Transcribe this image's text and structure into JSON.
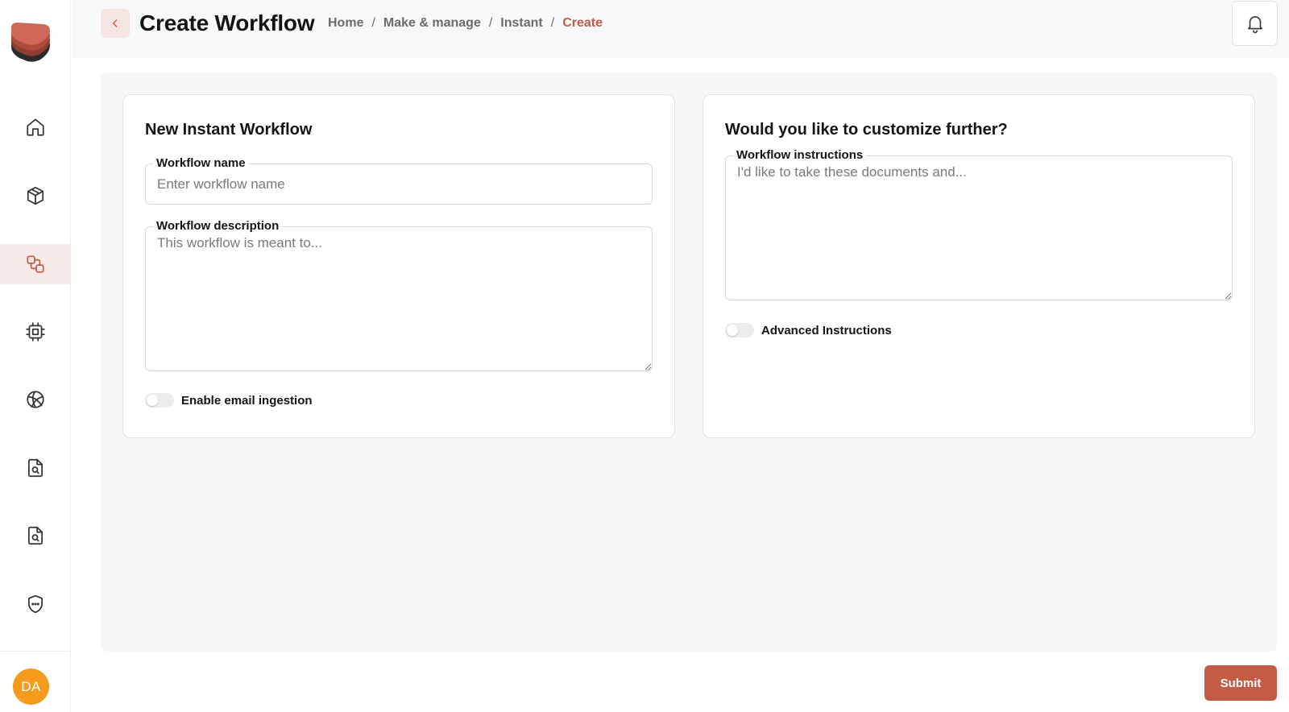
{
  "header": {
    "title": "Create Workflow",
    "breadcrumb": [
      "Home",
      "Make & manage",
      "Instant",
      "Create"
    ]
  },
  "sidebar": {
    "items": [
      {
        "icon": "home-icon"
      },
      {
        "icon": "box-icon"
      },
      {
        "icon": "workflow-icon",
        "active": true
      },
      {
        "icon": "cpu-icon"
      },
      {
        "icon": "globe-icon"
      },
      {
        "icon": "file-search-icon"
      },
      {
        "icon": "file-search-icon"
      },
      {
        "icon": "shield-icon"
      }
    ],
    "avatar_initials": "DA"
  },
  "left_card": {
    "title": "New Instant Workflow",
    "name_label": "Workflow name",
    "name_placeholder": "Enter workflow name",
    "description_label": "Workflow description",
    "description_placeholder": "This workflow is meant to...",
    "toggle_label": "Enable email ingestion",
    "toggle_on": false
  },
  "right_card": {
    "title": "Would you like to customize further?",
    "instructions_label": "Workflow instructions",
    "instructions_placeholder": "I'd like to take these documents and...",
    "toggle_label": "Advanced Instructions",
    "toggle_on": false
  },
  "footer": {
    "submit_label": "Submit"
  },
  "colors": {
    "accent": "#c45b47",
    "accent_light": "#f6e6e3",
    "avatar_bg": "#f59b1e"
  }
}
